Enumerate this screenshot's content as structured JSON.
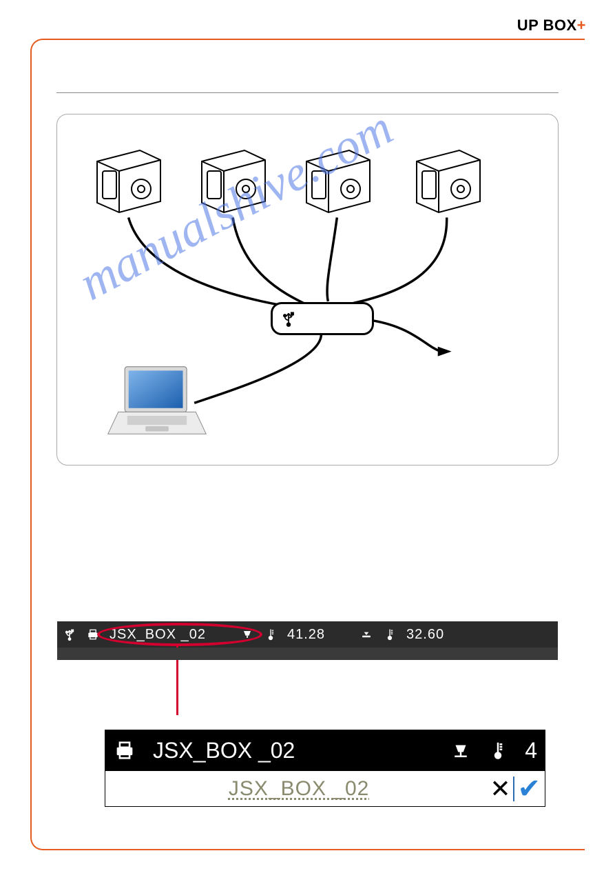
{
  "brand": {
    "name": "UP BOX",
    "plus": "+"
  },
  "watermark": "manualshive.com",
  "statusbar": {
    "printer_name": "JSX_BOX _02",
    "nozzle_temp": "41.28",
    "bed_temp": "32.60"
  },
  "statusbar_large": {
    "printer_name": "JSX_BOX _02",
    "nozzle_temp_partial": "4"
  },
  "rename": {
    "value": "JSX_BOX _02"
  },
  "icons": {
    "usb": "usb-icon",
    "printer": "printer-icon",
    "thermometer": "thermometer-icon",
    "nozzle": "nozzle-icon",
    "close": "close-icon",
    "confirm": "check-icon"
  }
}
